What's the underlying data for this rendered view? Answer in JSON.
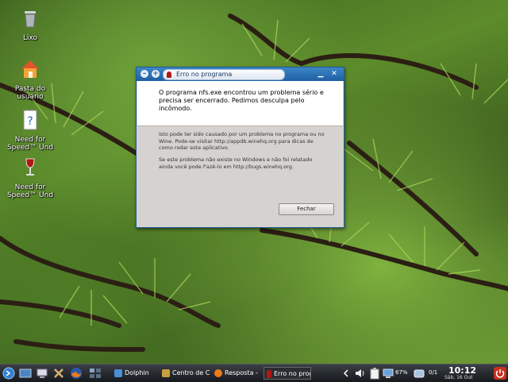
{
  "desktop": {
    "icons": [
      {
        "label": "Lixo"
      },
      {
        "label": "Pasta do\nusuário"
      },
      {
        "label": "Need for\nSpeed™ Und"
      },
      {
        "label": "Need for\nSpeed™ Und"
      }
    ]
  },
  "dialog": {
    "title": "Erro no programa",
    "message": "O programa nfs.exe encontrou um problema sério e precisa ser encerrado. Pedimos desculpa pelo incômodo.",
    "info1": "Isto pode ter sido causado por um problema no programa ou no Wine. Pode-se visitar http://appdb.winehq.org para dicas de como rodar este aplicativo.",
    "info2": "Se este problema não existe no Windows e não foi relatado ainda você pode f'azê-lo em http://bugs.winehq.org.",
    "close_label": "Fechar",
    "colors": {
      "titlebar": "#1f5fa3",
      "body": "#d6d2d0"
    }
  },
  "taskbar": {
    "tasks": [
      {
        "label": "Dolphin",
        "icon": "folder-icon"
      },
      {
        "label": "Centro de C",
        "icon": "settings-icon"
      },
      {
        "label": "Resposta -",
        "icon": "firefox-icon"
      },
      {
        "label": "Erro no prog",
        "icon": "wine-icon"
      }
    ],
    "battery": "67%",
    "pager": "0/1",
    "clock_time": "10:12",
    "clock_date": "Sáb, 16 Out"
  }
}
